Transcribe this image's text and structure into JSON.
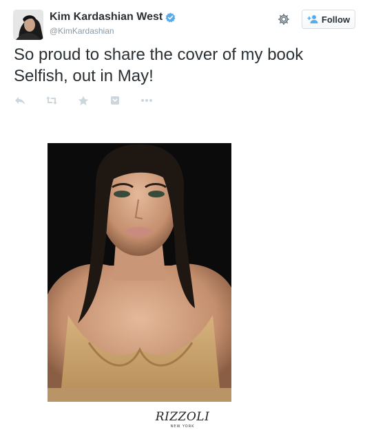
{
  "user": {
    "display_name": "Kim Kardashian West",
    "handle": "@KimKardashian",
    "verified": true
  },
  "header": {
    "follow_label": "Follow",
    "icons": [
      "gear-icon",
      "follow-person-icon"
    ]
  },
  "tweet": {
    "text_line1": "So proud to share the cover of my book",
    "text_line2": "Selfish, out in May!"
  },
  "actions": [
    {
      "name": "reply-icon"
    },
    {
      "name": "retweet-icon"
    },
    {
      "name": "favorite-icon"
    },
    {
      "name": "pocket-icon"
    },
    {
      "name": "more-icon"
    }
  ],
  "media": {
    "publisher_name": "RIZZOLI",
    "publisher_sub": "NEW YORK"
  },
  "colors": {
    "verified_blue": "#55acee",
    "icon_gray": "#ccd6dd",
    "handle_gray": "#8899a6",
    "text": "#292f33",
    "follow_blue": "#55acee"
  }
}
